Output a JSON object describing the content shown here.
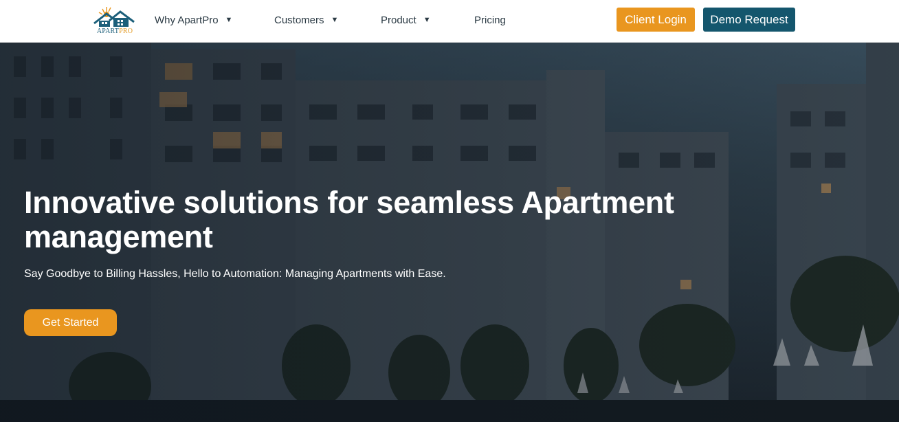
{
  "brand": {
    "logo_text_main": "APART",
    "logo_text_accent": "PRO",
    "colors": {
      "orange": "#e9961f",
      "teal": "#14566d"
    }
  },
  "nav": {
    "items": [
      {
        "label": "Why ApartPro",
        "has_dropdown": true
      },
      {
        "label": "Customers",
        "has_dropdown": true
      },
      {
        "label": "Product",
        "has_dropdown": true
      },
      {
        "label": "Pricing",
        "has_dropdown": false
      }
    ],
    "caret": "▼"
  },
  "header_buttons": {
    "login": "Client Login",
    "demo": "Demo Request"
  },
  "hero": {
    "title": "Innovative solutions for seamless Apartment management",
    "subtitle": "Say Goodbye to Billing Hassles, Hello to Automation: Managing Apartments with Ease.",
    "cta": "Get Started",
    "background_image": "apartment-buildings-at-dusk"
  }
}
